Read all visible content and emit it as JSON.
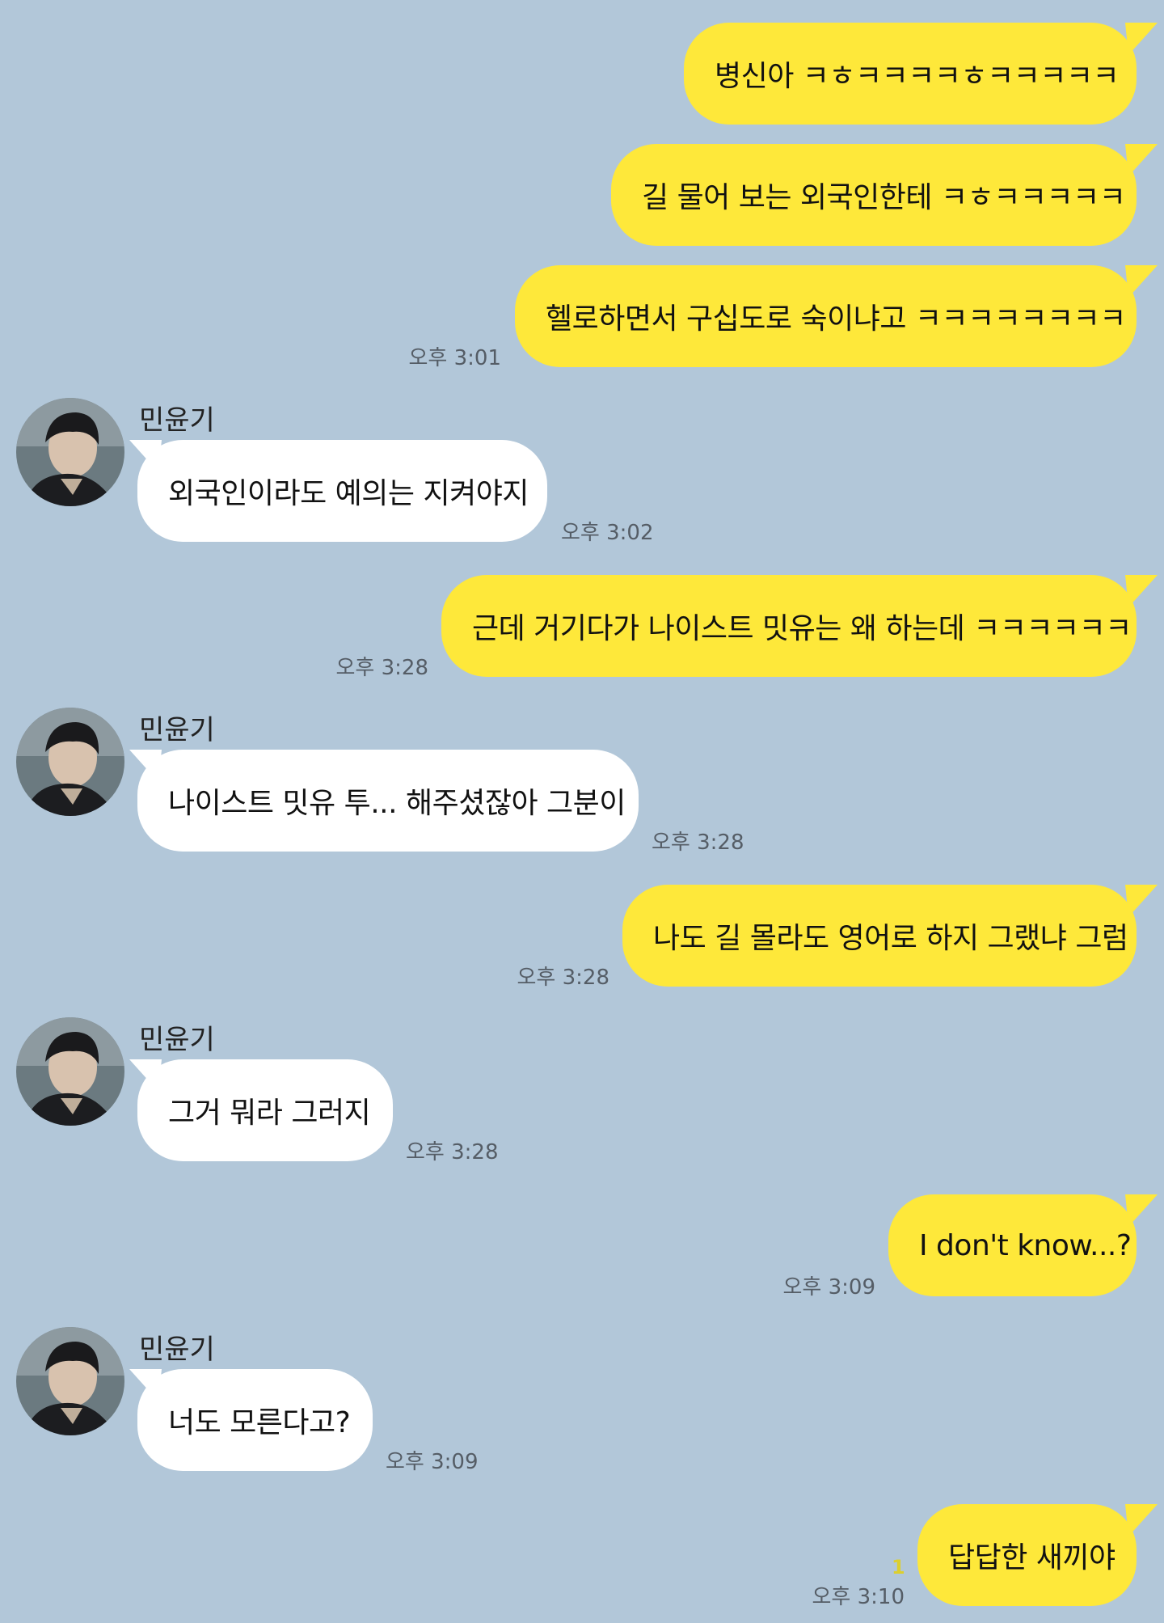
{
  "chat": {
    "messages": [
      {
        "from": "me",
        "text": "병신아 ㅋㅎㅋㅋㅋㅋㅎㅋㅋㅋㅋㅋ"
      },
      {
        "from": "me",
        "text": "길 물어 보는 외국인한테 ㅋㅎㅋㅋㅋㅋㅋ"
      },
      {
        "from": "me",
        "text": "헬로하면서 구십도로 숙이냐고 ㅋㅋㅋㅋㅋㅋㅋㅋ",
        "time": "오후 3:01"
      },
      {
        "from": "them",
        "sender": "민윤기",
        "text": "외국인이라도 예의는 지켜야지",
        "time": "오후 3:02"
      },
      {
        "from": "me",
        "text": "근데 거기다가 나이스트 밋유는 왜 하는데 ㅋㅋㅋㅋㅋㅋ",
        "time": "오후 3:28"
      },
      {
        "from": "them",
        "sender": "민윤기",
        "text": "나이스트 밋유 투... 해주셨잖아 그분이",
        "time": "오후 3:28"
      },
      {
        "from": "me",
        "text": "나도 길 몰라도 영어로 하지 그랬냐 그럼",
        "time": "오후 3:28"
      },
      {
        "from": "them",
        "sender": "민윤기",
        "text": "그거 뭐라 그러지",
        "time": "오후 3:28"
      },
      {
        "from": "me",
        "text": "I don't know...?",
        "time": "오후 3:09"
      },
      {
        "from": "them",
        "sender": "민윤기",
        "text": "너도 모른다고?",
        "time": "오후 3:09"
      },
      {
        "from": "me",
        "text": "답답한 새끼야",
        "time": "오후 3:10",
        "unread": "1"
      }
    ]
  },
  "colors": {
    "background": "#b2c7d9",
    "my_bubble": "#fee83a",
    "their_bubble": "#ffffff",
    "unread": "#dccf2e"
  },
  "icons": {
    "avatar": "profile-photo-avatar"
  }
}
